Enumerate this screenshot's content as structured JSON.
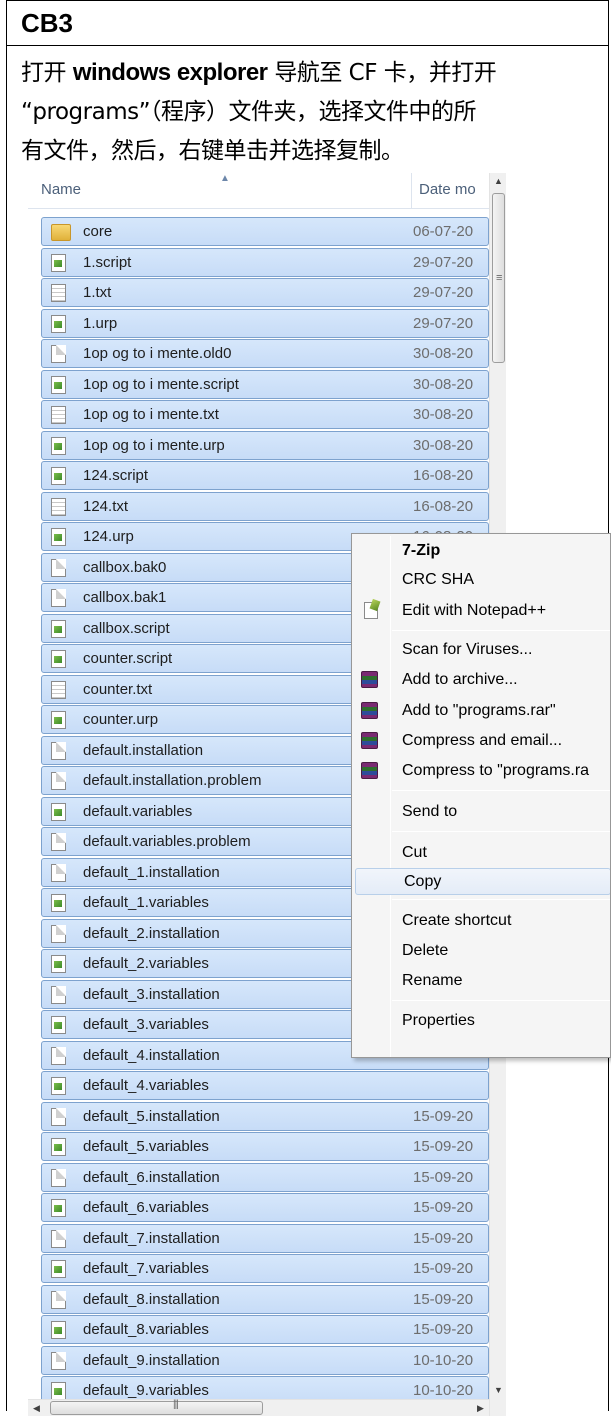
{
  "section": {
    "title": "CB3"
  },
  "instruction": {
    "line1_pre": "打开 ",
    "line1_bold": "windows explorer",
    "line1_post": " 导航至 CF 卡，并打开",
    "line2": "“programs”（程序）文件夹，选择文件中的所",
    "line3": "有文件，然后，右键单击并选择复制。"
  },
  "explorer": {
    "columns": {
      "name": "Name",
      "date": "Date mo"
    },
    "files": [
      {
        "name": "core",
        "date": "06-07-20",
        "icon": "folder-icon"
      },
      {
        "name": "1.script",
        "date": "29-07-20",
        "icon": "script-file-icon"
      },
      {
        "name": "1.txt",
        "date": "29-07-20",
        "icon": "text-file-icon"
      },
      {
        "name": "1.urp",
        "date": "29-07-20",
        "icon": "script-file-icon"
      },
      {
        "name": "1op og to i mente.old0",
        "date": "30-08-20",
        "icon": "file-icon"
      },
      {
        "name": "1op og to i mente.script",
        "date": "30-08-20",
        "icon": "script-file-icon"
      },
      {
        "name": "1op og to i mente.txt",
        "date": "30-08-20",
        "icon": "text-file-icon"
      },
      {
        "name": "1op og to i mente.urp",
        "date": "30-08-20",
        "icon": "script-file-icon"
      },
      {
        "name": "124.script",
        "date": "16-08-20",
        "icon": "script-file-icon"
      },
      {
        "name": "124.txt",
        "date": "16-08-20",
        "icon": "text-file-icon"
      },
      {
        "name": "124.urp",
        "date": "16-08-20",
        "icon": "script-file-icon"
      },
      {
        "name": "callbox.bak0",
        "date": "",
        "icon": "file-icon"
      },
      {
        "name": "callbox.bak1",
        "date": "",
        "icon": "file-icon"
      },
      {
        "name": "callbox.script",
        "date": "",
        "icon": "script-file-icon"
      },
      {
        "name": "counter.script",
        "date": "",
        "icon": "script-file-icon"
      },
      {
        "name": "counter.txt",
        "date": "",
        "icon": "text-file-icon"
      },
      {
        "name": "counter.urp",
        "date": "",
        "icon": "script-file-icon"
      },
      {
        "name": "default.installation",
        "date": "",
        "icon": "file-icon"
      },
      {
        "name": "default.installation.problem",
        "date": "",
        "icon": "file-icon"
      },
      {
        "name": "default.variables",
        "date": "",
        "icon": "script-file-icon"
      },
      {
        "name": "default.variables.problem",
        "date": "",
        "icon": "file-icon"
      },
      {
        "name": "default_1.installation",
        "date": "",
        "icon": "file-icon"
      },
      {
        "name": "default_1.variables",
        "date": "",
        "icon": "script-file-icon"
      },
      {
        "name": "default_2.installation",
        "date": "",
        "icon": "file-icon"
      },
      {
        "name": "default_2.variables",
        "date": "",
        "icon": "script-file-icon"
      },
      {
        "name": "default_3.installation",
        "date": "",
        "icon": "file-icon"
      },
      {
        "name": "default_3.variables",
        "date": "",
        "icon": "script-file-icon"
      },
      {
        "name": "default_4.installation",
        "date": "",
        "icon": "file-icon"
      },
      {
        "name": "default_4.variables",
        "date": "",
        "icon": "script-file-icon"
      },
      {
        "name": "default_5.installation",
        "date": "15-09-20",
        "icon": "file-icon"
      },
      {
        "name": "default_5.variables",
        "date": "15-09-20",
        "icon": "script-file-icon"
      },
      {
        "name": "default_6.installation",
        "date": "15-09-20",
        "icon": "file-icon"
      },
      {
        "name": "default_6.variables",
        "date": "15-09-20",
        "icon": "script-file-icon"
      },
      {
        "name": "default_7.installation",
        "date": "15-09-20",
        "icon": "file-icon"
      },
      {
        "name": "default_7.variables",
        "date": "15-09-20",
        "icon": "script-file-icon"
      },
      {
        "name": "default_8.installation",
        "date": "15-09-20",
        "icon": "file-icon"
      },
      {
        "name": "default_8.variables",
        "date": "15-09-20",
        "icon": "script-file-icon"
      },
      {
        "name": "default_9.installation",
        "date": "10-10-20",
        "icon": "file-icon"
      },
      {
        "name": "default_9.variables",
        "date": "10-10-20",
        "icon": "script-file-icon"
      }
    ]
  },
  "context_menu": {
    "items": [
      {
        "label": "7-Zip",
        "bold": true,
        "icon": ""
      },
      {
        "label": "CRC SHA",
        "bold": false,
        "icon": ""
      },
      {
        "label": "Edit with Notepad++",
        "bold": false,
        "icon": "notepad-plus-plus-icon"
      },
      {
        "label": "Scan for Viruses...",
        "bold": false,
        "icon": ""
      },
      {
        "label": "Add to archive...",
        "bold": false,
        "icon": "winrar-icon"
      },
      {
        "label": "Add to \"programs.rar\"",
        "bold": false,
        "icon": "winrar-icon"
      },
      {
        "label": "Compress and email...",
        "bold": false,
        "icon": "winrar-icon"
      },
      {
        "label": "Compress to \"programs.ra",
        "bold": false,
        "icon": "winrar-icon"
      },
      {
        "label": "Send to",
        "bold": false,
        "icon": ""
      },
      {
        "label": "Cut",
        "bold": false,
        "icon": ""
      },
      {
        "label": "Copy",
        "bold": false,
        "icon": "",
        "highlighted": true
      },
      {
        "label": "Create shortcut",
        "bold": false,
        "icon": ""
      },
      {
        "label": "Delete",
        "bold": false,
        "icon": ""
      },
      {
        "label": "Rename",
        "bold": false,
        "icon": ""
      },
      {
        "label": "Properties",
        "bold": false,
        "icon": ""
      }
    ]
  }
}
